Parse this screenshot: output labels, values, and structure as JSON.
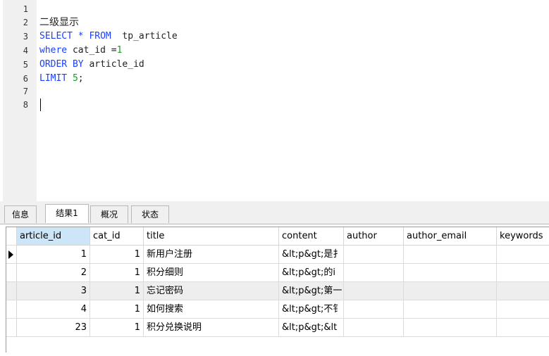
{
  "editor": {
    "lines": [
      {
        "no": "1",
        "text": ""
      },
      {
        "no": "2",
        "text": "二级显示"
      },
      {
        "no": "3",
        "kw1": "SELECT * FROM",
        "rest": "  tp_article"
      },
      {
        "no": "4",
        "kw1": "where",
        "rest": " cat_id =",
        "num": "1"
      },
      {
        "no": "5",
        "kw1": "ORDER BY",
        "rest": " article_id"
      },
      {
        "no": "6",
        "kw1": "LIMIT",
        "rest": " ",
        "num": "5",
        "tail": ";"
      },
      {
        "no": "7",
        "text": ""
      },
      {
        "no": "8",
        "text": ""
      }
    ],
    "colors": {
      "keyword": "#1a3fff",
      "number": "#1aa11a",
      "text": "#222222"
    }
  },
  "tabs": [
    {
      "label": "信息",
      "active": false
    },
    {
      "label": "结果1",
      "active": true
    },
    {
      "label": "概况",
      "active": false
    },
    {
      "label": "状态",
      "active": false
    }
  ],
  "grid": {
    "columns": [
      "article_id",
      "cat_id",
      "title",
      "content",
      "author",
      "author_email",
      "keywords"
    ],
    "rows": [
      {
        "article_id": "1",
        "cat_id": "1",
        "title": "新用户注册",
        "content": "&lt;p&gt;是扌",
        "author": "",
        "author_email": "",
        "keywords": ""
      },
      {
        "article_id": "2",
        "cat_id": "1",
        "title": "积分细则",
        "content": "&lt;p&gt;的i",
        "author": "",
        "author_email": "",
        "keywords": ""
      },
      {
        "article_id": "3",
        "cat_id": "1",
        "title": "忘记密码",
        "content": "&lt;p&gt;第一",
        "author": "",
        "author_email": "",
        "keywords": ""
      },
      {
        "article_id": "4",
        "cat_id": "1",
        "title": "如何搜索",
        "content": "&lt;p&gt;不钅",
        "author": "",
        "author_email": "",
        "keywords": ""
      },
      {
        "article_id": "23",
        "cat_id": "1",
        "title": "积分兑换说明",
        "content": "&lt;p&gt;&lt",
        "author": "",
        "author_email": "",
        "keywords": ""
      }
    ],
    "current_row": 0,
    "highlight_color": "#cde6f7",
    "alt_row_color": "#eeeeee"
  }
}
